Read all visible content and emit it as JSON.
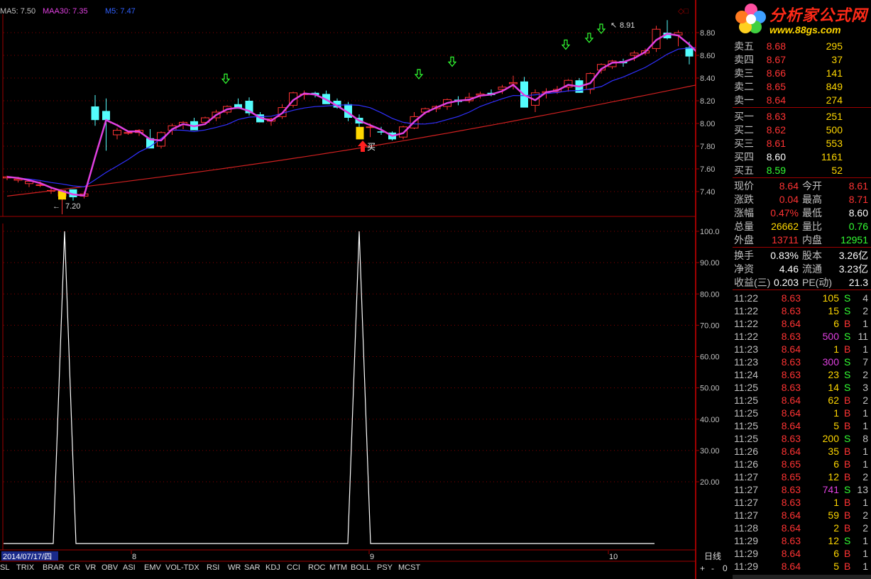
{
  "indicator_bar": {
    "ma5": "MA5: 7.50",
    "maa30": "MAA30: 7.35",
    "m5": "M5: 7.47"
  },
  "main_chart_labels": {
    "high_label": "8.91",
    "low_label": "7.20",
    "buy_label": "买"
  },
  "price_axis": [
    "8.80",
    "8.60",
    "8.40",
    "8.20",
    "8.00",
    "7.80",
    "7.60",
    "7.40"
  ],
  "sub_axis": [
    "100.0",
    "90.00",
    "80.00",
    "70.00",
    "60.00",
    "50.00",
    "40.00",
    "30.00",
    "20.00"
  ],
  "date_axis": {
    "current_date": "2014/07/17/四",
    "labels": [
      "8",
      "9",
      "10"
    ],
    "period": "日线"
  },
  "tabs": [
    "SL",
    "TRIX",
    "BRAR",
    "CR",
    "VR",
    "OBV",
    "ASI",
    "EMV",
    "VOL-TDX",
    "RSI",
    "WR",
    "SAR",
    "KDJ",
    "CCI",
    "ROC",
    "MTM",
    "BOLL",
    "PSY",
    "MCST"
  ],
  "zoom_controls": [
    "+",
    "-",
    "0"
  ],
  "logo": {
    "brand": "分析家公式网",
    "url": "www.88gs.com"
  },
  "order_book": {
    "sell": [
      {
        "label": "卖五",
        "price": "8.68",
        "vol": "295"
      },
      {
        "label": "卖四",
        "price": "8.67",
        "vol": "37"
      },
      {
        "label": "卖三",
        "price": "8.66",
        "vol": "141"
      },
      {
        "label": "卖二",
        "price": "8.65",
        "vol": "849"
      },
      {
        "label": "卖一",
        "price": "8.64",
        "vol": "274"
      }
    ],
    "buy": [
      {
        "label": "买一",
        "price": "8.63",
        "vol": "251"
      },
      {
        "label": "买二",
        "price": "8.62",
        "vol": "500"
      },
      {
        "label": "买三",
        "price": "8.61",
        "vol": "553"
      },
      {
        "label": "买四",
        "price": "8.60",
        "vol": "1161"
      },
      {
        "label": "买五",
        "price": "8.59",
        "vol": "52"
      }
    ]
  },
  "quote": {
    "now_label": "现价",
    "now": "8.64",
    "open_label": "今开",
    "open": "8.61",
    "chg_label": "涨跌",
    "chg": "0.04",
    "high_label": "最高",
    "high": "8.71",
    "pct_label": "涨幅",
    "pct": "0.47%",
    "low_label": "最低",
    "low": "8.60",
    "vol_label": "总量",
    "vol": "26662",
    "ratio_label": "量比",
    "ratio": "0.76",
    "outer_label": "外盘",
    "outer": "13711",
    "inner_label": "内盘",
    "inner": "12951"
  },
  "fundamentals": {
    "turnover_label": "换手",
    "turnover": "0.83%",
    "shares_label": "股本",
    "shares": "3.26亿",
    "nav_label": "净资",
    "nav": "4.46",
    "float_label": "流通",
    "float": "3.23亿",
    "eps_label": "收益(三)",
    "eps": "0.203",
    "pe_label": "PE(动)",
    "pe": "21.3"
  },
  "ticks": [
    {
      "t": "11:22",
      "p": "8.63",
      "q": "105",
      "d": "S",
      "n": "4"
    },
    {
      "t": "11:22",
      "p": "8.63",
      "q": "15",
      "d": "S",
      "n": "2"
    },
    {
      "t": "11:22",
      "p": "8.64",
      "q": "6",
      "d": "B",
      "n": "1"
    },
    {
      "t": "11:22",
      "p": "8.63",
      "q": "500",
      "d": "S",
      "n": "11"
    },
    {
      "t": "11:23",
      "p": "8.64",
      "q": "1",
      "d": "B",
      "n": "1"
    },
    {
      "t": "11:23",
      "p": "8.63",
      "q": "300",
      "d": "S",
      "n": "7"
    },
    {
      "t": "11:24",
      "p": "8.63",
      "q": "23",
      "d": "S",
      "n": "2"
    },
    {
      "t": "11:25",
      "p": "8.63",
      "q": "14",
      "d": "S",
      "n": "3"
    },
    {
      "t": "11:25",
      "p": "8.64",
      "q": "62",
      "d": "B",
      "n": "2"
    },
    {
      "t": "11:25",
      "p": "8.64",
      "q": "1",
      "d": "B",
      "n": "1"
    },
    {
      "t": "11:25",
      "p": "8.64",
      "q": "5",
      "d": "B",
      "n": "1"
    },
    {
      "t": "11:25",
      "p": "8.63",
      "q": "200",
      "d": "S",
      "n": "8"
    },
    {
      "t": "11:26",
      "p": "8.64",
      "q": "35",
      "d": "B",
      "n": "1"
    },
    {
      "t": "11:26",
      "p": "8.65",
      "q": "6",
      "d": "B",
      "n": "1"
    },
    {
      "t": "11:27",
      "p": "8.65",
      "q": "12",
      "d": "B",
      "n": "2"
    },
    {
      "t": "11:27",
      "p": "8.63",
      "q": "741",
      "d": "S",
      "n": "13"
    },
    {
      "t": "11:27",
      "p": "8.63",
      "q": "1",
      "d": "B",
      "n": "1"
    },
    {
      "t": "11:27",
      "p": "8.64",
      "q": "59",
      "d": "B",
      "n": "2"
    },
    {
      "t": "11:28",
      "p": "8.64",
      "q": "2",
      "d": "B",
      "n": "2"
    },
    {
      "t": "11:29",
      "p": "8.63",
      "q": "12",
      "d": "S",
      "n": "1"
    },
    {
      "t": "11:29",
      "p": "8.64",
      "q": "6",
      "d": "B",
      "n": "1"
    },
    {
      "t": "11:29",
      "p": "8.64",
      "q": "5",
      "d": "B",
      "n": "1"
    }
  ],
  "colors": {
    "up": "#ff3333",
    "down": "#54fcfc",
    "ma_fast": "#e040e0",
    "ma_mid": "#3030ff",
    "ma_slow": "#d02020",
    "grid": "#8b0000"
  }
}
